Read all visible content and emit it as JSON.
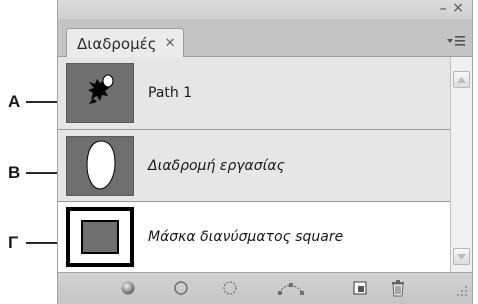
{
  "callouts": [
    "A",
    "B",
    "Γ"
  ],
  "panel": {
    "tab_label": "Διαδρομές",
    "tab_close_icon": "close-icon",
    "minimize_glyph": "–",
    "close_glyph": "×",
    "menu_icon": "panel-menu-icon"
  },
  "paths": [
    {
      "name": "Path 1",
      "italic": false,
      "thumbnail": "shape-thumbnail"
    },
    {
      "name": "Διαδρομή εργασίας",
      "italic": true,
      "thumbnail": "ellipse-thumbnail"
    },
    {
      "name": "Μάσκα διανύσματος square",
      "italic": true,
      "thumbnail": "square-mask-thumbnail"
    }
  ],
  "footer_tools": [
    "fill-path-icon",
    "stroke-path-icon",
    "load-selection-icon",
    "make-work-path-icon",
    "new-path-icon",
    "trash-icon"
  ]
}
